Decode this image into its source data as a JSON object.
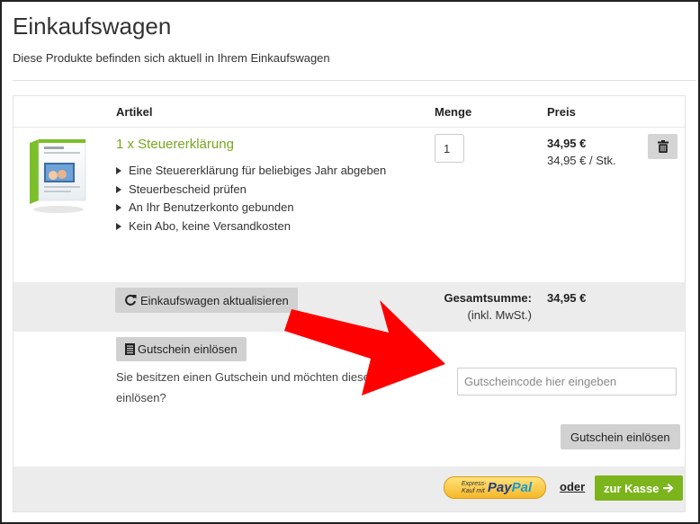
{
  "page": {
    "title": "Einkaufswagen",
    "subtitle": "Diese Produkte befinden sich aktuell in Ihrem Einkaufswagen"
  },
  "table": {
    "headers": {
      "article": "Artikel",
      "quantity": "Menge",
      "price": "Preis"
    }
  },
  "item": {
    "name": "1 x Steuererklärung",
    "features": [
      "Eine Steuererklärung für beliebiges Jahr abgeben",
      "Steuerbescheid prüfen",
      "An Ihr Benutzerkonto gebunden",
      "Kein Abo, keine Versandkosten"
    ],
    "quantity": "1",
    "price": "34,95 €",
    "unit_price": "34,95 € / Stk.",
    "delete_icon": "trash-icon"
  },
  "totals": {
    "update_label": "Einkaufswagen aktualisieren",
    "update_icon": "refresh-icon",
    "total_label": "Gesamtsumme:",
    "total_note": "(inkl. MwSt.)",
    "total_value": "34,95 €"
  },
  "voucher": {
    "toggle_label": "Gutschein einlösen",
    "toggle_icon": "list-icon",
    "description": "Sie besitzen einen Gutschein und möchten diesen jetzt einlösen?",
    "placeholder": "Gutscheincode hier eingeben",
    "submit_label": "Gutschein einlösen"
  },
  "checkout": {
    "paypal_small": "Express-Kauf mit",
    "paypal_pay": "Pay",
    "paypal_pal": "Pal",
    "or_label": "oder",
    "checkout_label": "zur Kasse",
    "checkout_icon": "arrow-right-icon"
  },
  "colors": {
    "accent_green": "#7cb41c",
    "product_green": "#79a61e",
    "annotation_red": "#ff0000"
  }
}
